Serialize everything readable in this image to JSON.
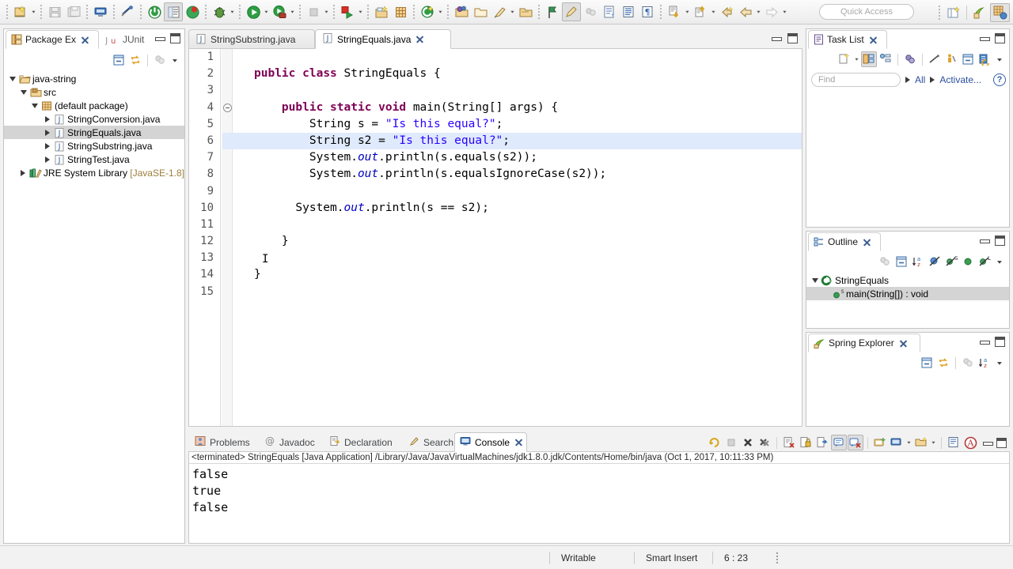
{
  "toolbar": {
    "quick_access_placeholder": "Quick Access",
    "icons": [
      "new-wizard-icon",
      "save-icon",
      "save-all-icon",
      "print-icon",
      "toggle-breakpoint-icon",
      "run-last-tool-icon",
      "open-task-icon",
      "refresh-icon",
      "debug-icon",
      "run-icon",
      "run-external-tool-icon",
      "terminate-icon",
      "coverage-icon",
      "new-java-project-icon",
      "new-package-icon",
      "new-class-icon",
      "open-type-icon",
      "search-icon",
      "open-resource-icon",
      "toggle-markers-icon",
      "marker-icon",
      "next-annotation-icon",
      "previous-annotation-icon",
      "last-edit-location-icon",
      "back-icon",
      "forward-icon"
    ],
    "perspective_icons": [
      "open-perspective-icon",
      "java-perspective-icon",
      "spring-perspective-icon"
    ]
  },
  "package_explorer": {
    "tabs": [
      {
        "label": "Package Ex",
        "icon": "package-explorer-icon",
        "active": true
      },
      {
        "label": "JUnit",
        "icon": "junit-icon",
        "active": false
      }
    ],
    "toolbar_icons": [
      "collapse-all-icon",
      "link-with-editor-icon",
      "view-menu-filter-icon",
      "view-menu-icon"
    ],
    "tree": [
      {
        "label": "java-string",
        "icon": "project-icon",
        "indent": 0,
        "twisty": "down",
        "selected": false
      },
      {
        "label": "src",
        "icon": "source-folder-icon",
        "indent": 1,
        "twisty": "down",
        "selected": false
      },
      {
        "label": "(default package)",
        "icon": "package-icon",
        "indent": 2,
        "twisty": "down",
        "selected": false
      },
      {
        "label": "StringConversion.java",
        "icon": "java-file-icon",
        "indent": 3,
        "twisty": "right",
        "selected": false
      },
      {
        "label": "StringEquals.java",
        "icon": "java-file-icon",
        "indent": 3,
        "twisty": "right",
        "selected": true
      },
      {
        "label": "StringSubstring.java",
        "icon": "java-file-icon",
        "indent": 3,
        "twisty": "right",
        "selected": false
      },
      {
        "label": "StringTest.java",
        "icon": "java-file-icon",
        "indent": 3,
        "twisty": "right",
        "selected": false
      },
      {
        "label": "JRE System Library",
        "suffix": " [JavaSE-1.8]",
        "icon": "jre-library-icon",
        "indent": 1,
        "twisty": "right",
        "selected": false
      }
    ]
  },
  "editor": {
    "tabs": [
      {
        "label": "StringSubstring.java",
        "icon": "java-file-icon",
        "active": false,
        "closable": false
      },
      {
        "label": "StringEquals.java",
        "icon": "java-file-icon",
        "active": true,
        "closable": true
      }
    ],
    "highlighted_line": 6,
    "folding_line": 4,
    "lines": [
      {
        "n": 1,
        "tokens": []
      },
      {
        "n": 2,
        "tokens": [
          {
            "t": "kw",
            "v": "public"
          },
          {
            "t": "p",
            "v": " "
          },
          {
            "t": "kw",
            "v": "class"
          },
          {
            "t": "p",
            "v": " StringEquals {"
          }
        ]
      },
      {
        "n": 3,
        "tokens": []
      },
      {
        "n": 4,
        "tokens": [
          {
            "t": "p",
            "v": "    "
          },
          {
            "t": "kw",
            "v": "public"
          },
          {
            "t": "p",
            "v": " "
          },
          {
            "t": "kw",
            "v": "static"
          },
          {
            "t": "p",
            "v": " "
          },
          {
            "t": "kw",
            "v": "void"
          },
          {
            "t": "p",
            "v": " main(String[] args) {"
          }
        ]
      },
      {
        "n": 5,
        "tokens": [
          {
            "t": "p",
            "v": "        String s = "
          },
          {
            "t": "str",
            "v": "\"Is this equal?\""
          },
          {
            "t": "p",
            "v": ";"
          }
        ]
      },
      {
        "n": 6,
        "tokens": [
          {
            "t": "p",
            "v": "        String s2 = "
          },
          {
            "t": "str",
            "v": "\"Is this equal?\""
          },
          {
            "t": "p",
            "v": ";"
          }
        ]
      },
      {
        "n": 7,
        "tokens": [
          {
            "t": "p",
            "v": "        System."
          },
          {
            "t": "fld",
            "v": "out"
          },
          {
            "t": "p",
            "v": ".println(s.equals(s2));"
          }
        ]
      },
      {
        "n": 8,
        "tokens": [
          {
            "t": "p",
            "v": "        System."
          },
          {
            "t": "fld",
            "v": "out"
          },
          {
            "t": "p",
            "v": ".println(s.equalsIgnoreCase(s2));"
          }
        ]
      },
      {
        "n": 9,
        "tokens": []
      },
      {
        "n": 10,
        "tokens": [
          {
            "t": "p",
            "v": "      System."
          },
          {
            "t": "fld",
            "v": "out"
          },
          {
            "t": "p",
            "v": ".println(s == s2);"
          }
        ]
      },
      {
        "n": 11,
        "tokens": []
      },
      {
        "n": 12,
        "tokens": [
          {
            "t": "p",
            "v": "    }"
          }
        ]
      },
      {
        "n": 13,
        "tokens": []
      },
      {
        "n": 14,
        "tokens": [
          {
            "t": "p",
            "v": "}"
          }
        ]
      },
      {
        "n": 15,
        "tokens": []
      }
    ]
  },
  "console": {
    "tabs": [
      {
        "label": "Problems",
        "icon": "problems-icon",
        "active": false
      },
      {
        "label": "Javadoc",
        "icon": "javadoc-icon",
        "active": false
      },
      {
        "label": "Declaration",
        "icon": "declaration-icon",
        "active": false
      },
      {
        "label": "Search",
        "icon": "search-icon",
        "active": false
      },
      {
        "label": "Console",
        "icon": "console-icon",
        "active": true
      }
    ],
    "header": "<terminated> StringEquals [Java Application] /Library/Java/JavaVirtualMachines/jdk1.8.0.jdk/Contents/Home/bin/java (Oct 1, 2017, 10:11:33 PM)",
    "output": [
      "false",
      "true",
      "false"
    ],
    "toolbar_icons": [
      "relaunch-icon",
      "terminate-icon",
      "remove-launch-icon",
      "remove-all-launches-icon",
      "clear-console-icon",
      "scroll-lock-icon",
      "word-wrap-icon",
      "pin-console-icon",
      "display-selected-console-icon",
      "new-console-view-icon",
      "open-console-icon",
      "show-console-on-output-icon",
      "error-log-icon"
    ]
  },
  "task_list": {
    "tab_label": "Task List",
    "tab_icon": "task-list-icon",
    "find_placeholder": "Find",
    "all_label": "All",
    "activate_label": "Activate...",
    "toolbar_icons": [
      "new-task-icon",
      "categorized-presentation-icon",
      "scheduled-presentation-icon",
      "focus-on-workweek-icon",
      "collapse-all-icon",
      "synchronize-changed-icon",
      "restore-tasks-icon",
      "refresh-icon",
      "view-menu-icon"
    ]
  },
  "outline": {
    "tab_label": "Outline",
    "tab_icon": "outline-icon",
    "toolbar_icons": [
      "focus-icon",
      "collapse-all-icon",
      "sort-icon",
      "hide-fields-icon",
      "hide-static-icon",
      "hide-nonpublic-icon",
      "hide-local-types-icon",
      "view-menu-icon"
    ],
    "tree": [
      {
        "label": "StringEquals",
        "icon": "class-icon",
        "indent": 0,
        "twisty": "down",
        "selected": false
      },
      {
        "label": "main(String[]) : void",
        "icon": "public-method-icon",
        "badge": "S",
        "indent": 1,
        "twisty": "none",
        "selected": true
      }
    ]
  },
  "spring_explorer": {
    "tab_label": "Spring Explorer",
    "tab_icon": "spring-icon",
    "toolbar_icons": [
      "collapse-all-icon",
      "link-with-editor-icon",
      "filter-icon",
      "sort-icon",
      "view-menu-icon"
    ]
  },
  "status_bar": {
    "writable": "Writable",
    "insert_mode": "Smart Insert",
    "position": "6 : 23"
  },
  "colors": {
    "keyword": "#7f0055",
    "string": "#2a00ff",
    "field": "#0000c0",
    "highlight_line": "#dfeafc",
    "selection": "#d4d4d4",
    "link": "#2b4f9e"
  }
}
